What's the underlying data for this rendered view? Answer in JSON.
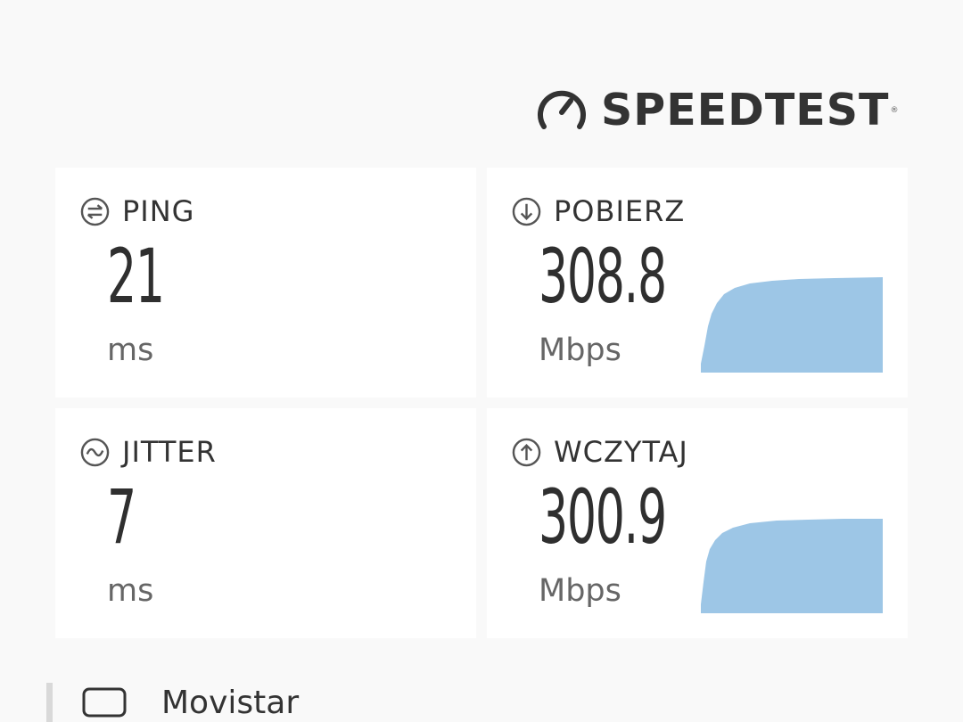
{
  "brand": {
    "name": "SPEEDTEST",
    "registered": "®"
  },
  "colors": {
    "background": "#f9f9f9",
    "card": "#ffffff",
    "graph_fill": "#9dc6e6",
    "text": "#333333",
    "unit_text": "#666666"
  },
  "results": {
    "ping": {
      "label": "PING",
      "value": "21",
      "unit": "ms",
      "icon": "ping-icon"
    },
    "download": {
      "label": "POBIERZ",
      "value": "308.8",
      "unit": "Mbps",
      "icon": "download-arrow-icon"
    },
    "jitter": {
      "label": "JITTER",
      "value": "7",
      "unit": "ms",
      "icon": "jitter-wave-icon"
    },
    "upload": {
      "label": "WCZYTAJ",
      "value": "300.9",
      "unit": "Mbps",
      "icon": "upload-arrow-icon"
    }
  },
  "provider": {
    "name": "Movistar",
    "icon": "device-icon"
  }
}
